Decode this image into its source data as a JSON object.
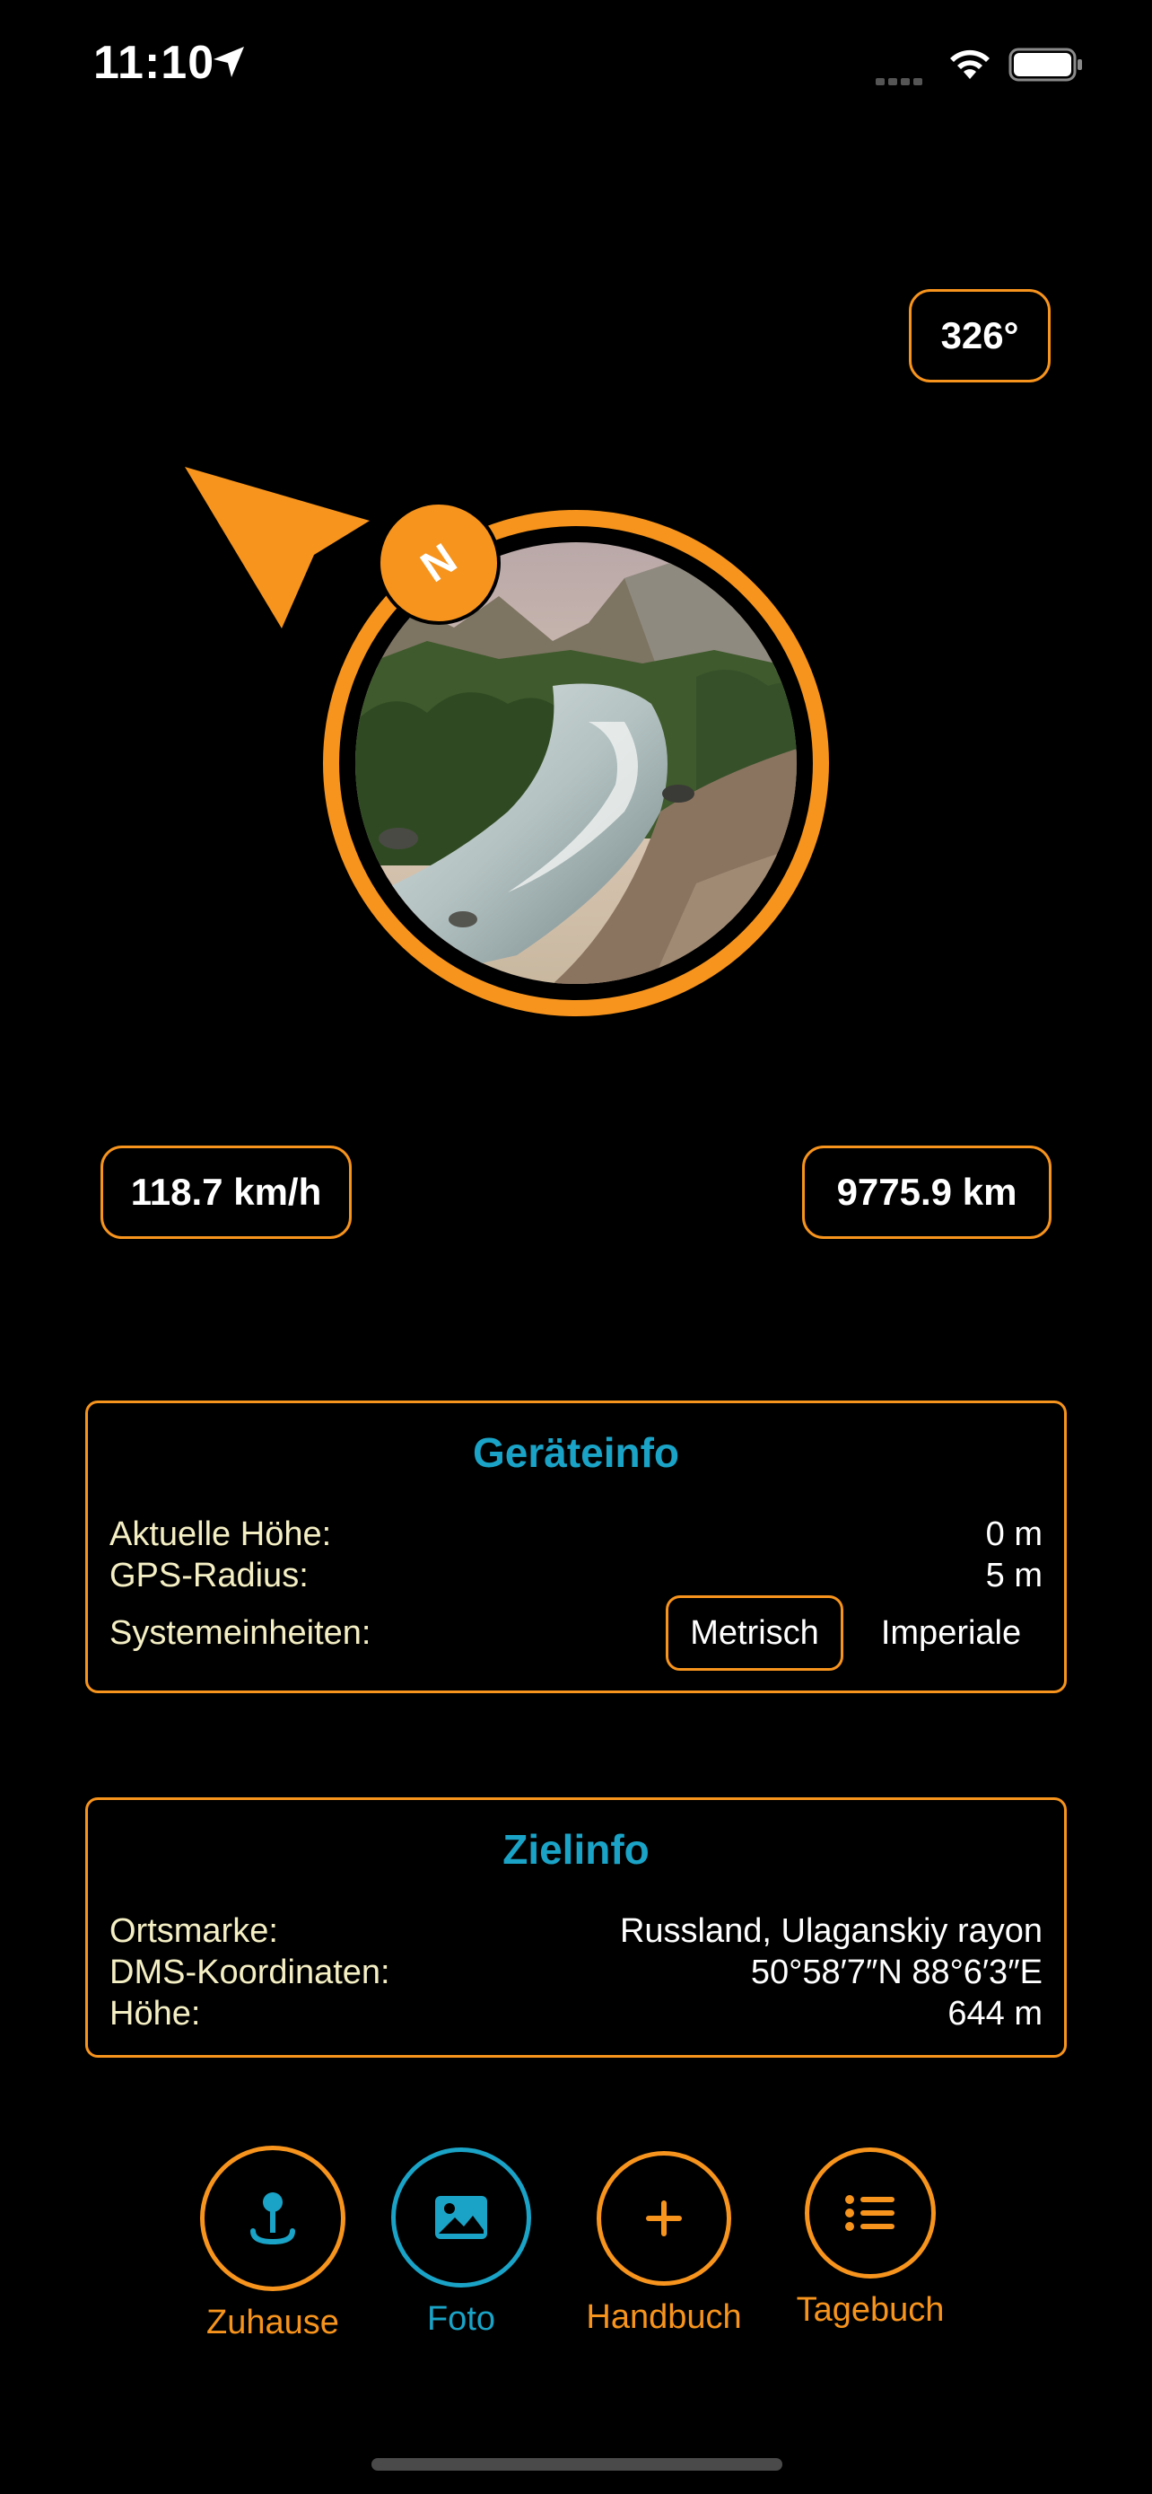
{
  "status_bar": {
    "time": "11:10"
  },
  "compass": {
    "heading": "326°",
    "north_label": "N"
  },
  "stats": {
    "speed": "118.7 km/h",
    "distance": "9775.9 km"
  },
  "device_info": {
    "title": "Geräteinfo",
    "altitude_label": "Aktuelle Höhe:",
    "altitude_value": "0 m",
    "gps_label": "GPS-Radius:",
    "gps_value": "5 m",
    "units_label": "Systemeinheiten:",
    "units_options": [
      "Metrisch",
      "Imperiale"
    ],
    "units_selected": "Metrisch"
  },
  "target_info": {
    "title": "Zielinfo",
    "landmark_label": "Ortsmarke:",
    "landmark_value": "Russland, Ulaganskiy rayon",
    "dms_label": "DMS-Koordinaten:",
    "dms_value": "50°58′7″N 88°6′3″E",
    "height_label": "Höhe:",
    "height_value": "644 m"
  },
  "actions": [
    {
      "label": "Zuhause",
      "icon": "home-pin-icon",
      "color": "#f7941d"
    },
    {
      "label": "Foto",
      "icon": "photo-icon",
      "color": "#1aa3c6"
    },
    {
      "label": "Handbuch",
      "icon": "plus-icon",
      "color": "#f7941d"
    },
    {
      "label": "Tagebuch",
      "icon": "list-icon",
      "color": "#f7941d"
    }
  ],
  "colors": {
    "accent_orange": "#f7941d",
    "accent_blue": "#1aa3c6",
    "label_cream": "#f5efc4",
    "background": "#000000"
  }
}
